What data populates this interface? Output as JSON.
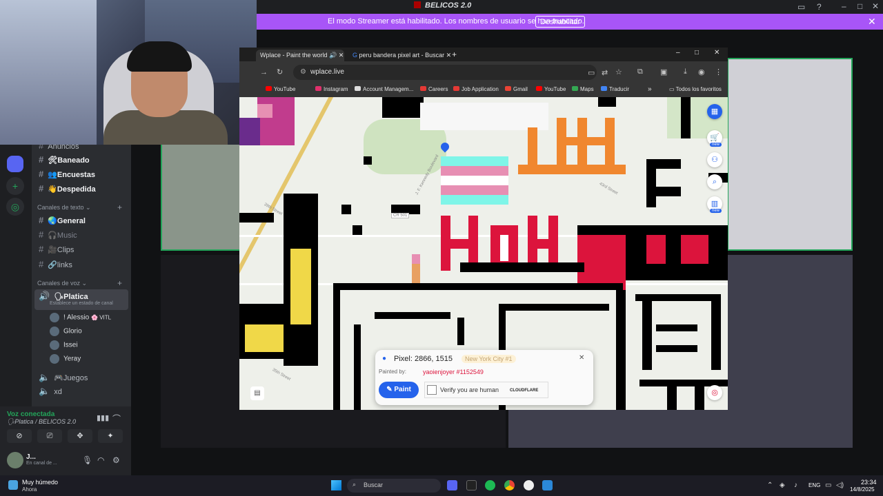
{
  "discord": {
    "title": "BELICOS 2.0",
    "streamer_banner": {
      "text": "El modo Streamer está habilitado. Los nombres de usuario se han truncado.",
      "button": "Deshabilitar",
      "close": "✕"
    },
    "channels": {
      "top": [
        {
          "label": "Anuncios"
        },
        {
          "label": "🛠Baneado"
        },
        {
          "label": "👥Encuestas"
        },
        {
          "label": "👋Despedida"
        }
      ],
      "text_category": "Canales de texto",
      "text_channels": [
        {
          "label": "🌏General"
        },
        {
          "label": "🎧Music"
        },
        {
          "label": "🎥Clips"
        },
        {
          "label": "🔗links"
        }
      ],
      "voice_category": "Canales de voz",
      "voice_channel": {
        "label": "🗣Platica",
        "status": "Establece un estado de canal"
      },
      "voice_users": [
        {
          "name": "! Alessio",
          "tag": "🌸 VITL"
        },
        {
          "name": "Glorio"
        },
        {
          "name": "Issei"
        },
        {
          "name": "Yeray"
        }
      ],
      "other_voice": [
        {
          "label": "🎮Juegos"
        },
        {
          "label": "xd"
        }
      ]
    },
    "voice_panel": {
      "status": "Voz conectada",
      "channel": "🗣Platica / BELICOS 2.0"
    },
    "user": {
      "name": "J...",
      "status": "En canal de ..."
    }
  },
  "browser": {
    "tabs": [
      {
        "label": "Wplace - Paint the world",
        "active": true
      },
      {
        "label": "peru bandera pixel art - Buscar"
      }
    ],
    "url": "wplace.live",
    "bookmarks": [
      {
        "label": "YouTube",
        "color": "#ff0000"
      },
      {
        "label": "Instagram",
        "color": "#e1306c"
      },
      {
        "label": "Account Managem...",
        "color": "#dddddd"
      },
      {
        "label": "Careers",
        "color": "#e53935"
      },
      {
        "label": "Job Application",
        "color": "#e53935"
      },
      {
        "label": "Gmail",
        "color": "#ea4335"
      },
      {
        "label": "YouTube",
        "color": "#ff0000"
      },
      {
        "label": "Maps",
        "color": "#34a853"
      },
      {
        "label": "Traducir",
        "color": "#4285f4"
      }
    ],
    "bookmarks_more": "»",
    "all_bookmarks": "Todos los favoritos"
  },
  "wplace": {
    "pixel_label": "Pixel: 2866, 1515",
    "location": "New York City #1",
    "painted_by_label": "Painted by:",
    "painted_by_user": "yaoienjoyer #1152549",
    "paint_button": "Paint",
    "captcha_text": "Verify you are human",
    "captcha_brand": "CLOUDFLARE",
    "map_labels": {
      "road1": "CR 501",
      "street1": "39th Street",
      "street2": "43rd Street",
      "street3": "35th Street",
      "avenue1": "J. F. Kennedy Boulevard"
    },
    "new_badge": "new"
  },
  "taskbar": {
    "weather_title": "Muy húmedo",
    "weather_sub": "Ahora",
    "search": "Buscar",
    "lang": "ENG",
    "time": "23:34",
    "date": "14/8/2025"
  }
}
